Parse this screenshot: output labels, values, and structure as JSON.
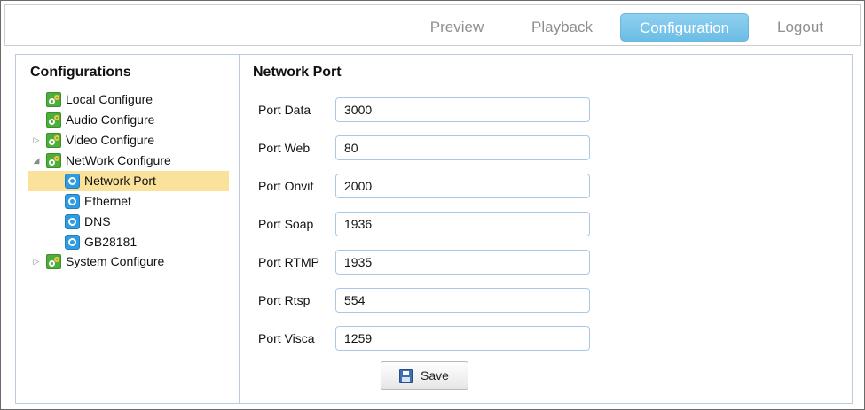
{
  "nav": {
    "tabs": [
      {
        "label": "Preview"
      },
      {
        "label": "Playback"
      },
      {
        "label": "Configuration",
        "active": true
      },
      {
        "label": "Logout"
      }
    ],
    "active_color": "#6bbde6"
  },
  "sidebar": {
    "title": "Configurations",
    "items": [
      {
        "label": "Local Configure",
        "icon": "gear-icon"
      },
      {
        "label": "Audio Configure",
        "icon": "gear-icon"
      },
      {
        "label": "Video Configure",
        "icon": "gear-icon",
        "expander": "▷"
      },
      {
        "label": "NetWork Configure",
        "icon": "gear-icon",
        "expander": "◢"
      },
      {
        "label": "Network Port",
        "icon": "settings-icon",
        "selected": true
      },
      {
        "label": "Ethernet",
        "icon": "settings-icon"
      },
      {
        "label": "DNS",
        "icon": "settings-icon"
      },
      {
        "label": "GB28181",
        "icon": "settings-icon"
      },
      {
        "label": "System Configure",
        "icon": "gear-icon",
        "expander": "▷"
      }
    ],
    "selected_color": "#fbe29b"
  },
  "content": {
    "title": "Network Port",
    "fields": [
      {
        "label": "Port Data",
        "value": "3000"
      },
      {
        "label": "Port Web",
        "value": "80"
      },
      {
        "label": "Port Onvif",
        "value": "2000"
      },
      {
        "label": "Port Soap",
        "value": "1936"
      },
      {
        "label": "Port RTMP",
        "value": "1935"
      },
      {
        "label": "Port Rtsp",
        "value": "554"
      },
      {
        "label": "Port Visca",
        "value": "1259"
      }
    ],
    "save_label": "Save",
    "save_icon": "save-icon"
  }
}
